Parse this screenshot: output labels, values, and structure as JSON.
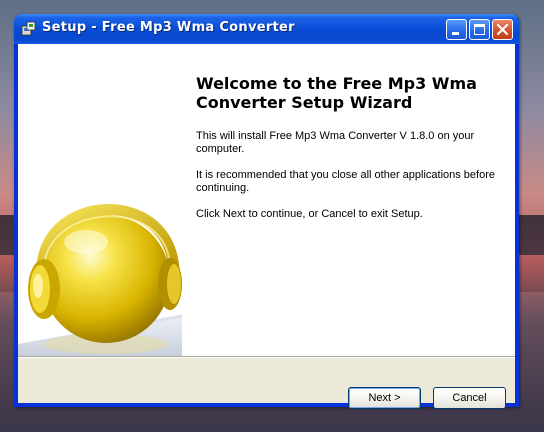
{
  "window": {
    "title": "Setup - Free Mp3 Wma Converter",
    "icon": "setup-installer-icon"
  },
  "titlebar_buttons": {
    "minimize_icon": "minimize-icon",
    "maximize_icon": "maximize-icon",
    "close_icon": "close-icon"
  },
  "wizard": {
    "heading": "Welcome to the Free Mp3 Wma Converter Setup Wizard",
    "install_text": "This will install Free Mp3 Wma Converter V 1.8.0 on your computer.",
    "recommend_text": "It is recommended that you close all other applications before continuing.",
    "continue_text": "Click Next to continue, or Cancel to exit Setup.",
    "side_image": "yellow-ball-with-headphones"
  },
  "buttons": {
    "next_label": "Next >",
    "cancel_label": "Cancel"
  },
  "colors": {
    "titlebar": "#0a4fd8",
    "dialog_bg": "#ece9d8",
    "close_button": "#d8502a"
  }
}
